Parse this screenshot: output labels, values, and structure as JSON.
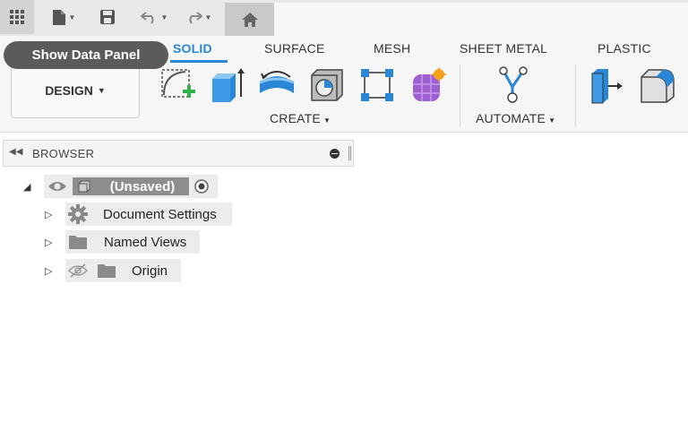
{
  "tooltip": {
    "text": "Show Data Panel"
  },
  "ribbon": {
    "tabs": [
      {
        "label": "SOLID",
        "active": true
      },
      {
        "label": "SURFACE",
        "active": false
      },
      {
        "label": "MESH",
        "active": false
      },
      {
        "label": "SHEET METAL",
        "active": false
      },
      {
        "label": "PLASTIC",
        "active": false
      }
    ],
    "workspace_label": "DESIGN",
    "groups": {
      "create": "CREATE",
      "automate": "AUTOMATE"
    }
  },
  "browser": {
    "title": "BROWSER",
    "root": {
      "label": "(Unsaved)"
    },
    "children": [
      {
        "label": "Document Settings",
        "icon": "gear-icon"
      },
      {
        "label": "Named Views",
        "icon": "folder-icon"
      },
      {
        "label": "Origin",
        "icon": "folder-icon",
        "hidden": true
      }
    ]
  },
  "colors": {
    "accent": "#2a86d6",
    "tooltip_bg": "#5b5b5b"
  }
}
